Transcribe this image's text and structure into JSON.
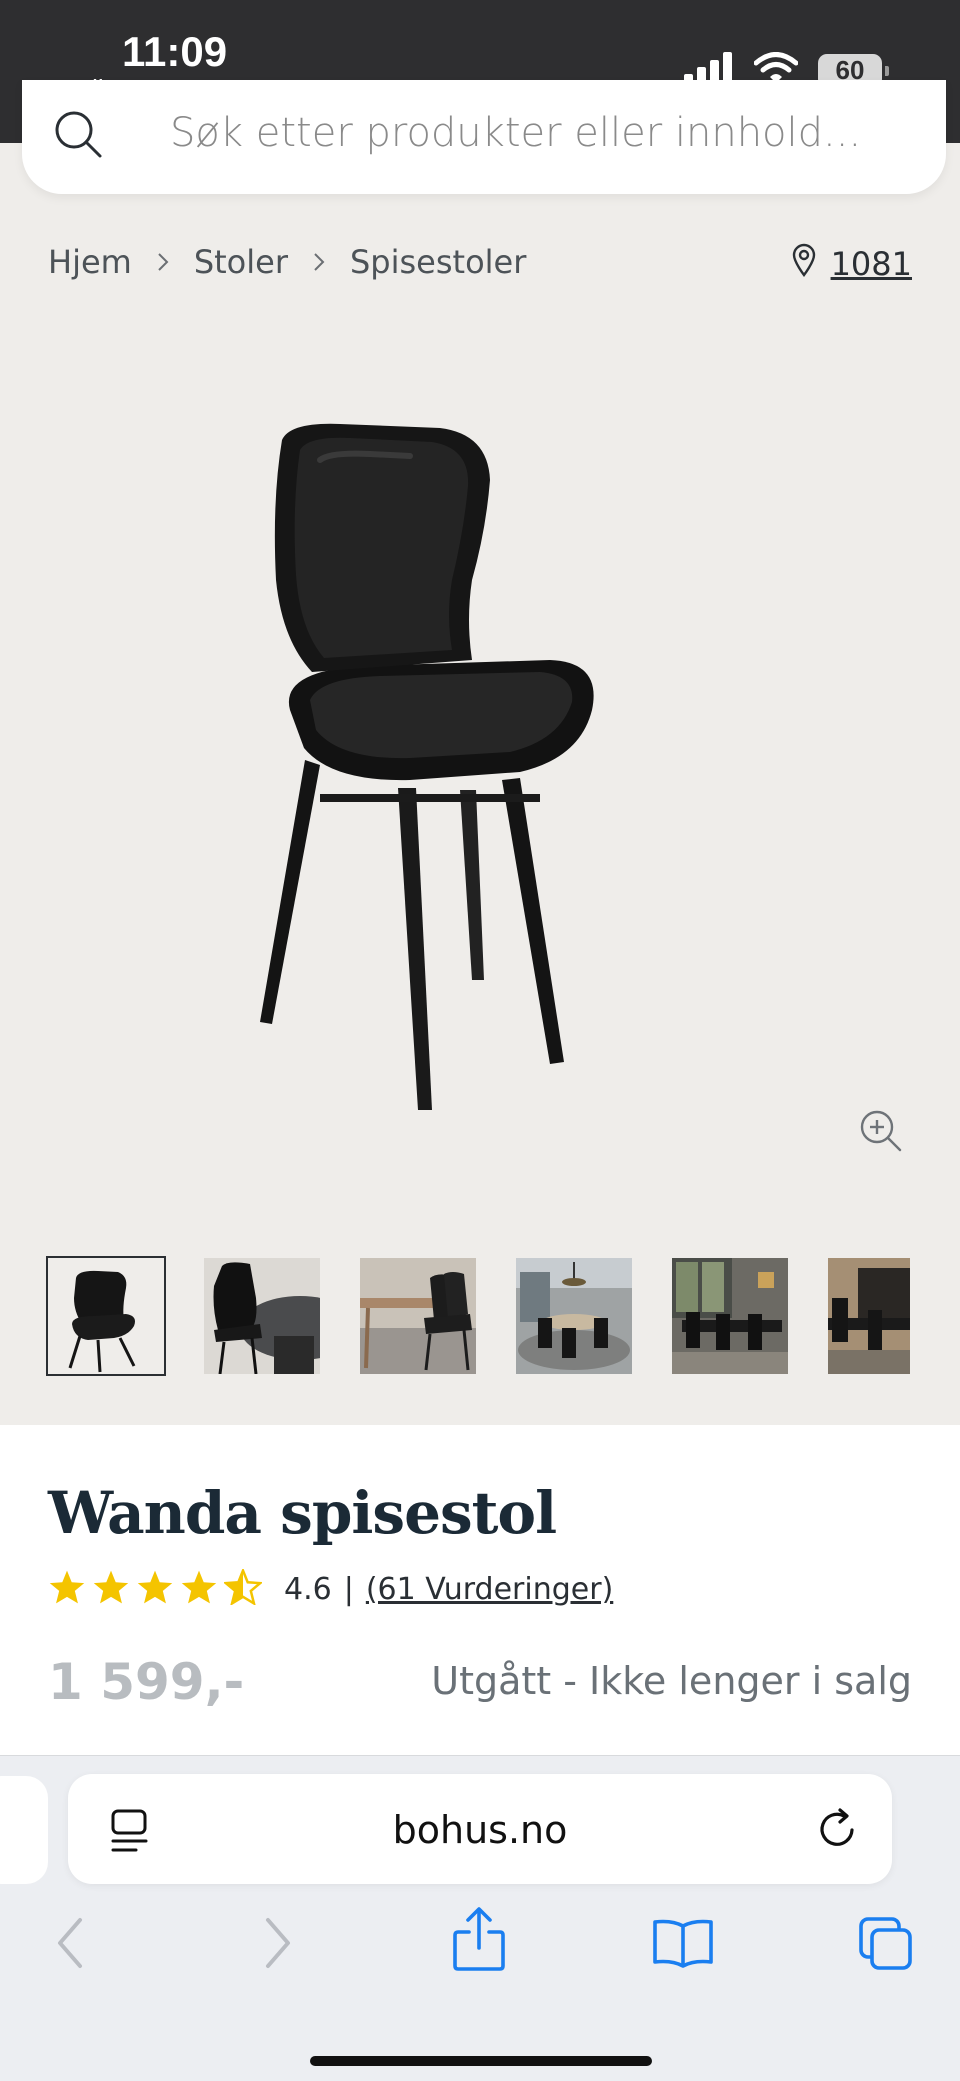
{
  "status_bar": {
    "time": "11:09",
    "back_label": "Mail",
    "battery": "60"
  },
  "search": {
    "placeholder": "Søk etter produkter eller innhold..."
  },
  "breadcrumb": {
    "items": [
      "Hjem",
      "Stoler",
      "Spisestoler"
    ],
    "location_code": "1081"
  },
  "product": {
    "title": "Wanda spisestol",
    "rating_value": "4.6",
    "rating_separator": "|",
    "rating_count": "(61 Vurderinger)",
    "stars": 4.5,
    "price": "1 599,-",
    "status": "Utgått - Ikke lenger i salg"
  },
  "safari": {
    "address": "bohus.no"
  },
  "colors": {
    "status_bar_bg": "#2e2e30",
    "page_bg": "#efedea",
    "star": "#f4c400",
    "safari_blue": "#1a7ef0"
  }
}
